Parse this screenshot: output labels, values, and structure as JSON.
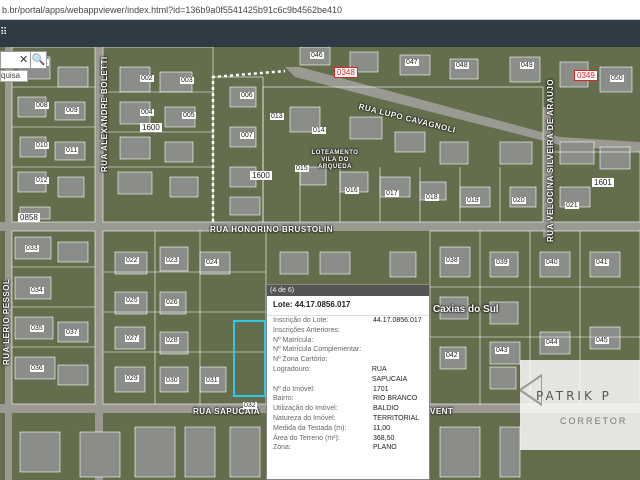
{
  "browser": {
    "url": "b.br/portal/apps/webappviewer/index.html?id=136b9a0f5541425b91c6c9b4562be410"
  },
  "toolbar": {
    "menu_glyph": "⠿"
  },
  "search": {
    "clear": "✕",
    "search_glyph": "🔍",
    "suggestion": "quisa"
  },
  "streets": {
    "honorino": "RUA HONORINO BRUSTOLIN",
    "sapucaia": "RUA SAPUCAIA",
    "alexandre": "RUA ALEXANDRE BOLETTI",
    "velocina": "RUA VELOCINA SILVEIRA DE ARAUJO",
    "lupo": "RUA LUPO CAVAGNOLI",
    "lerio": "RUA LERIO PESSOL",
    "vent": "VENT",
    "loteamento": "LOTEAMENTO VILA DO ARQUEDA"
  },
  "blocks": {
    "b1600a": "1600",
    "b1600b": "1600",
    "b0858": "0858",
    "b0349": "0349",
    "b1601": "1601",
    "b0348": "0348"
  },
  "lots": [
    "001",
    "002",
    "003",
    "004",
    "005",
    "006",
    "007",
    "008",
    "009",
    "010",
    "011",
    "012",
    "013",
    "014",
    "015",
    "016",
    "017",
    "018",
    "019",
    "020",
    "021",
    "022",
    "023",
    "024",
    "025",
    "026",
    "027",
    "028",
    "029",
    "030",
    "031",
    "032",
    "033",
    "034",
    "035",
    "036",
    "037",
    "038",
    "039",
    "040",
    "041",
    "042",
    "043",
    "044",
    "045",
    "046",
    "047",
    "048",
    "049",
    "050"
  ],
  "city_label": "Caxias do Sul",
  "popup": {
    "header": "(4 de 6)",
    "title": "Lote: 44.17.0856.017",
    "rows": [
      {
        "k": "Inscrição do Lote:",
        "v": "44.17.0856.017"
      },
      {
        "k": "Inscrições Anteriores:",
        "v": ""
      },
      {
        "k": "Nº Matrícula:",
        "v": ""
      },
      {
        "k": "Nº Matrícula Complementar:",
        "v": ""
      },
      {
        "k": "Nº Zona Cartório:",
        "v": ""
      },
      {
        "k": "Logradouro:",
        "v": "RUA SAPUCAIA"
      },
      {
        "k": "Nº do Imóvel:",
        "v": "1701"
      },
      {
        "k": "Bairro:",
        "v": "RIO BRANCO"
      },
      {
        "k": "Utilização do Imóvel:",
        "v": "BALDIO"
      },
      {
        "k": "Natureza do Imóvel:",
        "v": "TERRITORIAL"
      },
      {
        "k": "Medida da Testada (m):",
        "v": "11,00"
      },
      {
        "k": "Área do Terreno (m²):",
        "v": "368,50"
      },
      {
        "k": "Zona:",
        "v": "PLANO"
      }
    ]
  },
  "watermark": {
    "brand": "PATRIK P",
    "sub": "CORRETOR"
  },
  "colors": {
    "appbar": "#2f3b44",
    "selection": "#31c7e8",
    "block_label": "#d22222"
  }
}
